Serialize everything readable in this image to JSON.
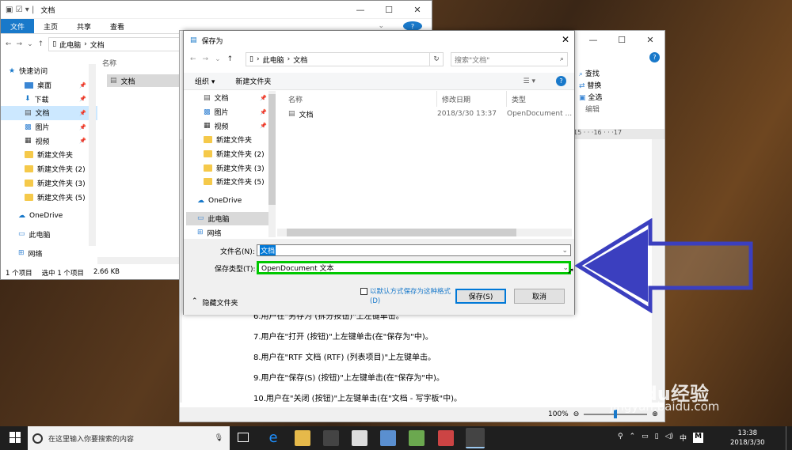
{
  "explorer": {
    "title": "文档",
    "ribbon_tabs": [
      "文件",
      "主页",
      "共享",
      "查看"
    ],
    "breadcrumb": [
      "此电脑",
      "文档"
    ],
    "column_name": "名称",
    "file_name": "文档",
    "nav_items": [
      {
        "label": "快速访问",
        "icon": "star-icon"
      },
      {
        "label": "桌面",
        "icon": "desktop-icon",
        "pinned": true
      },
      {
        "label": "下载",
        "icon": "download-icon",
        "pinned": true
      },
      {
        "label": "文档",
        "icon": "document-icon",
        "pinned": true,
        "selected": true
      },
      {
        "label": "图片",
        "icon": "picture-icon",
        "pinned": true
      },
      {
        "label": "视频",
        "icon": "video-icon",
        "pinned": true
      },
      {
        "label": "新建文件夹",
        "icon": "folder-icon"
      },
      {
        "label": "新建文件夹 (2)",
        "icon": "folder-icon"
      },
      {
        "label": "新建文件夹 (3)",
        "icon": "folder-icon"
      },
      {
        "label": "新建文件夹 (5)",
        "icon": "folder-icon"
      },
      {
        "label": "OneDrive",
        "icon": "cloud-icon"
      },
      {
        "label": "此电脑",
        "icon": "computer-icon"
      },
      {
        "label": "网络",
        "icon": "network-icon"
      }
    ],
    "status": {
      "count": "1 个项目",
      "selected": "选中 1 个项目",
      "size": "2.66 KB"
    }
  },
  "wordpad": {
    "edit_items": [
      "查找",
      "替换",
      "全选"
    ],
    "edit_group": "编辑",
    "ruler": "15 · · ·16 · · ·17",
    "lines": [
      "6.用户在\"另存为 (拆分按钮)\"上左键单击。",
      "7.用户在\"打开 (按钮)\"上左键单击(在\"保存为\"中)。",
      "8.用户在\"RTF 文档 (RTF) (列表项目)\"上左键单击。",
      "9.用户在\"保存(S) (按钮)\"上左键单击(在\"保存为\"中)。",
      "10.用户在\"关闭 (按钮)\"上左键单击(在\"文档 - 写字板\"中)。"
    ],
    "zoom": "100%"
  },
  "save_dialog": {
    "title": "保存为",
    "breadcrumb": [
      "此电脑",
      "文档"
    ],
    "search_placeholder": "搜索\"文档\"",
    "organize": "组织 ▾",
    "new_folder": "新建文件夹",
    "nav_items": [
      {
        "label": "文档",
        "icon": "document-icon",
        "pinned": true
      },
      {
        "label": "图片",
        "icon": "picture-icon",
        "pinned": true
      },
      {
        "label": "视频",
        "icon": "video-icon",
        "pinned": true
      },
      {
        "label": "新建文件夹",
        "icon": "folder-icon"
      },
      {
        "label": "新建文件夹 (2)",
        "icon": "folder-icon"
      },
      {
        "label": "新建文件夹 (3)",
        "icon": "folder-icon"
      },
      {
        "label": "新建文件夹 (5)",
        "icon": "folder-icon"
      },
      {
        "label": "OneDrive",
        "icon": "cloud-icon"
      },
      {
        "label": "此电脑",
        "icon": "computer-icon",
        "selected": true
      },
      {
        "label": "网络",
        "icon": "network-icon"
      }
    ],
    "columns": {
      "name": "名称",
      "modified": "修改日期",
      "type": "类型"
    },
    "rows": [
      {
        "name": "文档",
        "modified": "2018/3/30 13:37",
        "type": "OpenDocument ..."
      }
    ],
    "filename_label": "文件名(N):",
    "filename_value": "文档",
    "filetype_label": "保存类型(T):",
    "filetype_value": "OpenDocument 文本",
    "default_format_text": "以默认方式保存为这种格式(D)",
    "hide_folders": "隐藏文件夹",
    "save_button": "保存(S)",
    "cancel_button": "取消"
  },
  "taskbar": {
    "search_placeholder": "在这里输入你要搜索的内容",
    "tray_lang": "中",
    "tray_ime": "M",
    "time": "13:38",
    "date": "2018/3/30"
  },
  "watermark": {
    "brand": "Baidu经验",
    "url": "jingyan.baidu.com"
  },
  "colors": {
    "accent": "#1979ca",
    "highlight": "#00c800",
    "arrow": "#3b3fbf",
    "selection": "#cce8ff"
  }
}
